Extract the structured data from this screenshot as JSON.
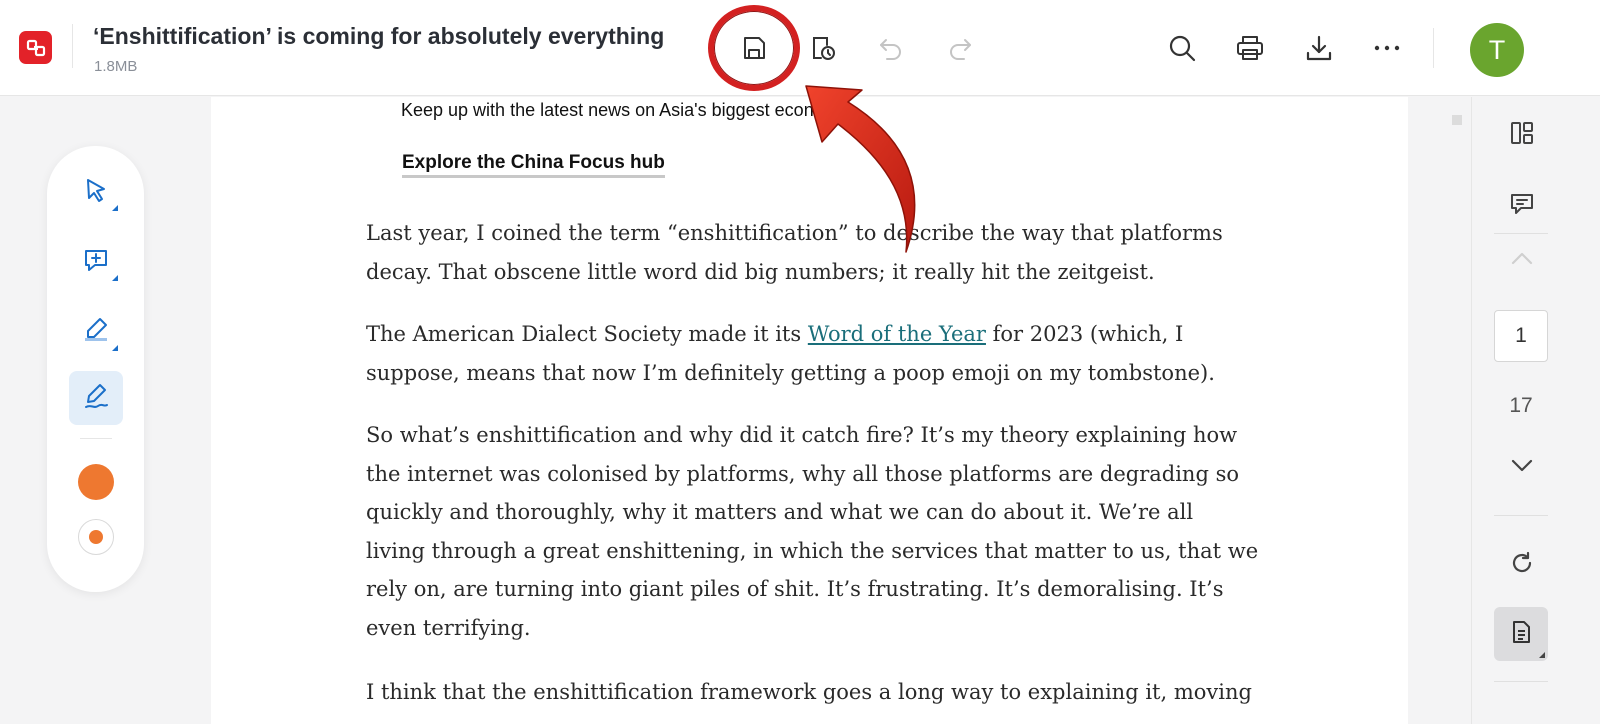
{
  "header": {
    "title": "‘Enshittification’ is coming for absolutely everything",
    "file_size": "1.8MB",
    "avatar_initial": "T"
  },
  "article": {
    "promo_text": "Keep up with the latest news on Asia's biggest economy.",
    "hub_link": "Explore the China Focus hub",
    "p1": [
      "Last year, I coined the term “enshittification” to describe the way that platforms",
      "decay. That obscene little word did big numbers; it really hit the zeitgeist."
    ],
    "p2_before_link": "The American Dialect Society made it its ",
    "p2_link": "Word of the Year",
    "p2_after_link": " for 2023 (which, I",
    "p2_line2": "suppose, means that now I’m definitely getting a poop emoji on my tombstone).",
    "p3": [
      "So what’s enshittification and why did it catch fire? It’s my theory explaining how",
      "the internet was colonised by platforms, why all those platforms are degrading so",
      "quickly and thoroughly, why it matters and what we can do about it. We’re all",
      "living through a great enshittening, in which the services that matter to us, that we",
      "rely on, are turning into giant piles of shit. It’s frustrating. It’s demoralising. It’s",
      "even terrifying."
    ],
    "p4": [
      "I think that the enshittification framework goes a long way to explaining it, moving"
    ]
  },
  "pager": {
    "current_page": "1",
    "total_pages": "17"
  },
  "colors": {
    "brand": "#e32229",
    "accent": "#1b6fc9",
    "pen_color": "#ee7830",
    "avatar": "#6aa52e",
    "highlight": "#d32121"
  }
}
